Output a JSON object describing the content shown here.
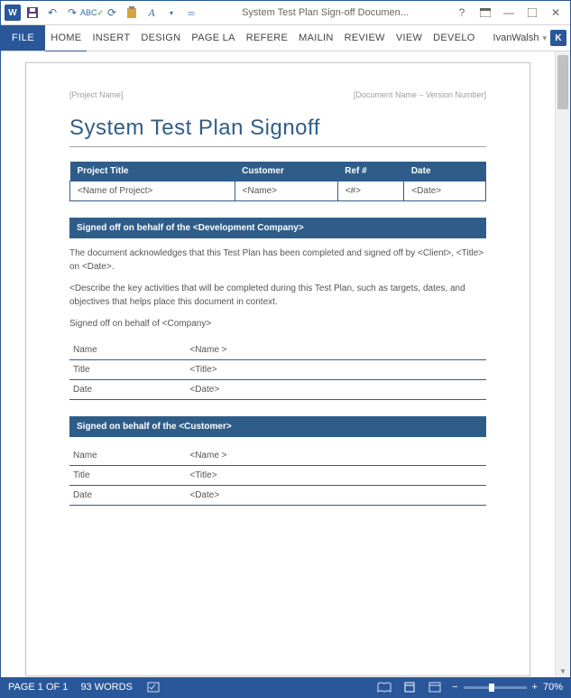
{
  "titlebar": {
    "title": "System Test Plan Sign-off Documen..."
  },
  "ribbon": {
    "file": "FILE",
    "tabs": [
      "HOME",
      "INSERT",
      "DESIGN",
      "PAGE LA",
      "REFERE",
      "MAILIN",
      "REVIEW",
      "VIEW",
      "DEVELO"
    ],
    "user": "IvanWalsh",
    "user_initial": "K"
  },
  "document": {
    "header_left": "[Project Name]",
    "header_right": "[Document Name – Version Number]",
    "title": "System Test Plan Signoff",
    "meta_headers": {
      "c1": "Project Title",
      "c2": "Customer",
      "c3": "Ref #",
      "c4": "Date"
    },
    "meta_values": {
      "c1": "<Name of Project>",
      "c2": "<Name>",
      "c3": "<#>",
      "c4": "<Date>"
    },
    "bar1": "Signed off on behalf of the <Development Company>",
    "para1": "The document acknowledges that this Test Plan has been completed and signed off by <Client>, <Title> on <Date>.",
    "para2": "<Describe the key activities that will be completed during this Test Plan, such as targets, dates, and objectives that helps place this document in context.",
    "para3": "Signed off on behalf of <Company>",
    "sign_labels": {
      "name": "Name",
      "title": "Title",
      "date": "Date"
    },
    "sign1": {
      "name": "<Name >",
      "title": "<Title>",
      "date": "<Date>"
    },
    "bar2": "Signed on behalf of the <Customer>",
    "sign2": {
      "name": "<Name >",
      "title": "<Title>",
      "date": "<Date>"
    }
  },
  "status": {
    "page": "PAGE 1 OF 1",
    "words": "93 WORDS",
    "zoom": "70%"
  }
}
